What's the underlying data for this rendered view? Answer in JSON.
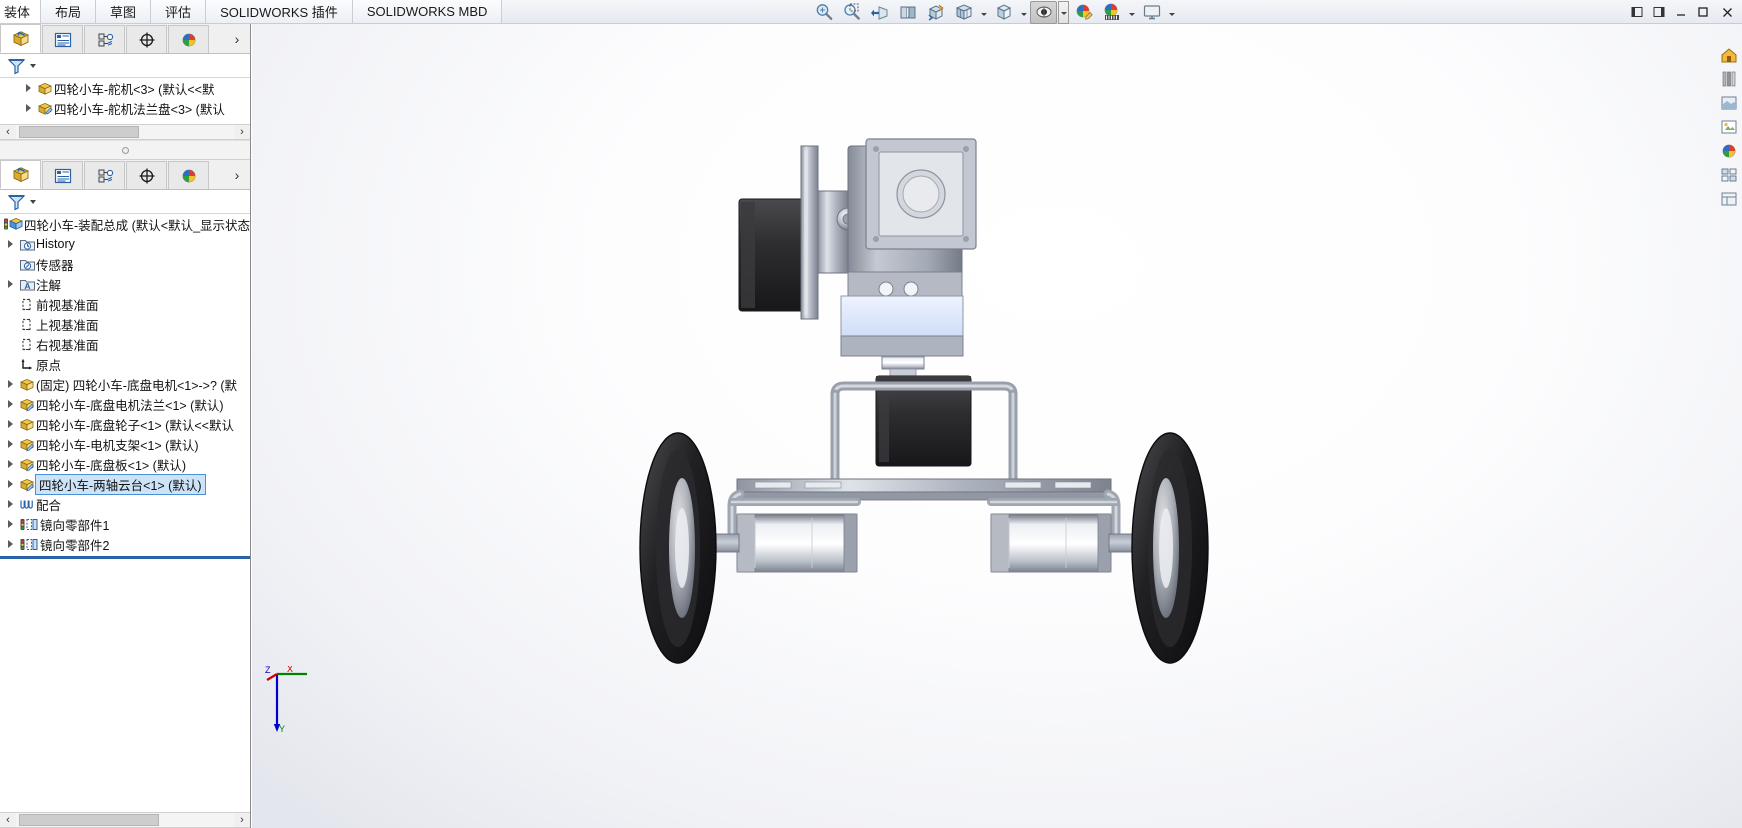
{
  "window": {
    "controls": [
      {
        "name": "restore-down-left",
        "glyph": "❐"
      },
      {
        "name": "expand-right",
        "glyph": "❐"
      },
      {
        "name": "minimize",
        "glyph": "—"
      },
      {
        "name": "maximize",
        "glyph": "❐"
      },
      {
        "name": "close",
        "glyph": "✕"
      }
    ]
  },
  "menubar": {
    "tabs": [
      {
        "label": "装体",
        "active": true
      },
      {
        "label": "布局",
        "active": false
      },
      {
        "label": "草图",
        "active": false
      },
      {
        "label": "评估",
        "active": false
      },
      {
        "label": "SOLIDWORKS 插件",
        "active": false
      },
      {
        "label": "SOLIDWORKS MBD",
        "active": false
      }
    ]
  },
  "view_toolbar": {
    "buttons": [
      {
        "name": "zoom-to-fit-icon",
        "pressed": false,
        "dropdown": false
      },
      {
        "name": "zoom-to-area-icon",
        "pressed": false,
        "dropdown": false
      },
      {
        "name": "previous-view-icon",
        "pressed": false,
        "dropdown": false
      },
      {
        "name": "section-view-icon",
        "pressed": false,
        "dropdown": false
      },
      {
        "name": "view-orientation-icon",
        "pressed": false,
        "dropdown": false
      },
      {
        "name": "display-style-icon",
        "pressed": false,
        "dropdown": true
      },
      {
        "name": "hide-show-items-icon",
        "pressed": false,
        "dropdown": true
      },
      {
        "name": "edit-appearance-icon",
        "pressed": true,
        "dropdown": true
      },
      {
        "name": "apply-scene-icon",
        "pressed": false,
        "dropdown": false
      },
      {
        "name": "view-settings-icon",
        "pressed": false,
        "dropdown": true
      },
      {
        "name": "viewport-layout-icon",
        "pressed": false,
        "dropdown": true
      }
    ]
  },
  "panel_top": {
    "tabs": [
      {
        "name": "feature-manager-tab",
        "icon": "feature-tree-icon",
        "active": true
      },
      {
        "name": "property-manager-tab",
        "icon": "property-list-icon",
        "active": false
      },
      {
        "name": "configuration-manager-tab",
        "icon": "configuration-icon",
        "active": false
      },
      {
        "name": "dimxpert-manager-tab",
        "icon": "dimxpert-icon",
        "active": false
      },
      {
        "name": "display-manager-tab",
        "icon": "display-palette-icon",
        "active": false
      }
    ],
    "more_label": "›",
    "filter_placeholder": "",
    "tree": [
      {
        "label": "四轮小车-舵机<3>  (默认<<默",
        "icon": "component-icon",
        "indent": 1,
        "arrow": true,
        "selected": false
      },
      {
        "label": "四轮小车-舵机法兰盘<3>  (默认",
        "icon": "component-edit-icon",
        "indent": 1,
        "arrow": true,
        "selected": false
      }
    ],
    "scroll": {
      "left_arrow": "‹",
      "right_arrow": "›"
    }
  },
  "panel_bottom": {
    "tabs": [
      {
        "name": "feature-manager-tab",
        "icon": "feature-tree-icon",
        "active": true
      },
      {
        "name": "property-manager-tab",
        "icon": "property-list-icon",
        "active": false
      },
      {
        "name": "configuration-manager-tab",
        "icon": "configuration-icon",
        "active": false
      },
      {
        "name": "dimxpert-manager-tab",
        "icon": "dimxpert-icon",
        "active": false
      },
      {
        "name": "display-manager-tab",
        "icon": "display-palette-icon",
        "active": false
      }
    ],
    "more_label": "›",
    "tree": [
      {
        "label": "四轮小车-装配总成  (默认<默认_显示状态",
        "icon": "assembly-root-icon",
        "indent": 0,
        "arrow": false,
        "selected": false
      },
      {
        "label": "History",
        "icon": "history-folder-icon",
        "indent": 1,
        "arrow": true,
        "selected": false
      },
      {
        "label": "传感器",
        "icon": "sensors-folder-icon",
        "indent": 1,
        "arrow": false,
        "selected": false
      },
      {
        "label": "注解",
        "icon": "annotations-folder-icon",
        "indent": 1,
        "arrow": true,
        "selected": false
      },
      {
        "label": "前视基准面",
        "icon": "plane-icon",
        "indent": 1,
        "arrow": false,
        "selected": false
      },
      {
        "label": "上视基准面",
        "icon": "plane-icon",
        "indent": 1,
        "arrow": false,
        "selected": false
      },
      {
        "label": "右视基准面",
        "icon": "plane-icon",
        "indent": 1,
        "arrow": false,
        "selected": false
      },
      {
        "label": "原点",
        "icon": "origin-icon",
        "indent": 1,
        "arrow": false,
        "selected": false
      },
      {
        "label": "(固定) 四轮小车-底盘电机<1>->?  (默",
        "icon": "component-icon",
        "indent": 0,
        "arrow": true,
        "selected": false
      },
      {
        "label": "四轮小车-底盘电机法兰<1>  (默认)",
        "icon": "component-edit-icon",
        "indent": 0,
        "arrow": true,
        "selected": false
      },
      {
        "label": "四轮小车-底盘轮子<1>  (默认<<默认",
        "icon": "component-icon",
        "indent": 0,
        "arrow": true,
        "selected": false
      },
      {
        "label": "四轮小车-电机支架<1>  (默认)",
        "icon": "component-edit-icon",
        "indent": 0,
        "arrow": true,
        "selected": false
      },
      {
        "label": "四轮小车-底盘板<1>  (默认)",
        "icon": "component-edit-icon",
        "indent": 0,
        "arrow": true,
        "selected": false
      },
      {
        "label": "四轮小车-两轴云台<1>  (默认)",
        "icon": "component-edit-icon",
        "indent": 0,
        "arrow": true,
        "selected": true
      },
      {
        "label": "配合",
        "icon": "mates-icon",
        "indent": 0,
        "arrow": true,
        "selected": false
      },
      {
        "label": "镜向零部件1",
        "icon": "mirror-component-icon",
        "indent": 0,
        "arrow": true,
        "selected": false
      },
      {
        "label": "镜向零部件2",
        "icon": "mirror-component-icon",
        "indent": 0,
        "arrow": true,
        "selected": false
      }
    ],
    "scroll": {
      "left_arrow": "‹",
      "right_arrow": "›"
    }
  },
  "viewport": {
    "rail_buttons": [
      {
        "name": "view-home-icon"
      },
      {
        "name": "appearances-icon"
      },
      {
        "name": "scenes-icon"
      },
      {
        "name": "decals-icon"
      },
      {
        "name": "lights-cameras-icon"
      },
      {
        "name": "display-states-icon"
      },
      {
        "name": "custom-views-icon"
      }
    ],
    "triad": {
      "z_label": "Z",
      "x_label": "X",
      "y_label": "Y",
      "z_color": "#0000cc",
      "x_color": "#cc0000",
      "y_color": "#008000"
    },
    "model_name": "four-wheel-robot-car-assembly"
  },
  "colors": {
    "accent": "#4a90d9",
    "selection_fill": "#cde3f7",
    "panel_bg": "#ffffff",
    "toolbar_bg": "#eceff5"
  }
}
